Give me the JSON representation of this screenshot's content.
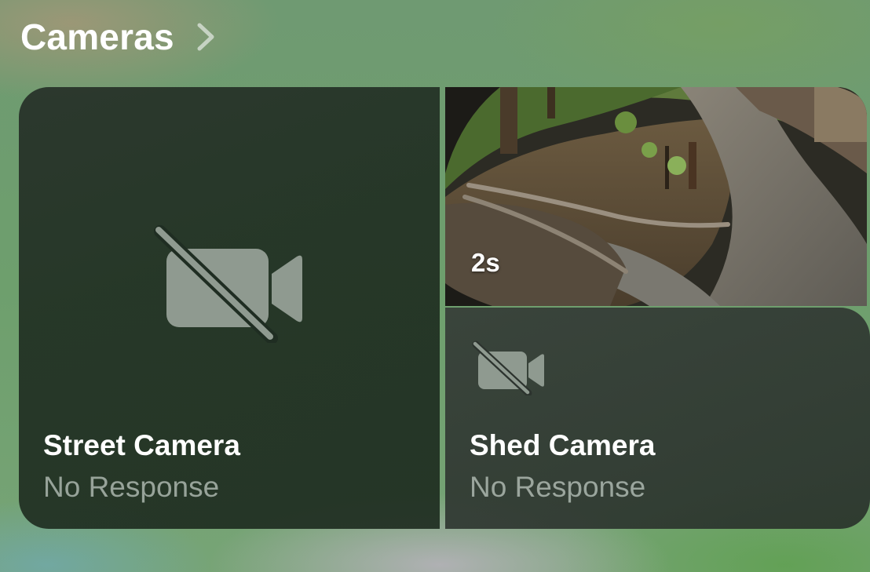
{
  "header": {
    "title": "Cameras",
    "chevron_icon": "chevron-right-icon"
  },
  "cameras": [
    {
      "name": "Street Camera",
      "status": "No Response",
      "icon": "video-slash-icon"
    },
    {
      "name": "Shed Camera",
      "status": "No Response",
      "icon": "video-slash-icon"
    }
  ],
  "snapshot": {
    "age_label": "2s"
  },
  "colors": {
    "icon": "#8f9a90",
    "status_text": "#9aa49b"
  }
}
